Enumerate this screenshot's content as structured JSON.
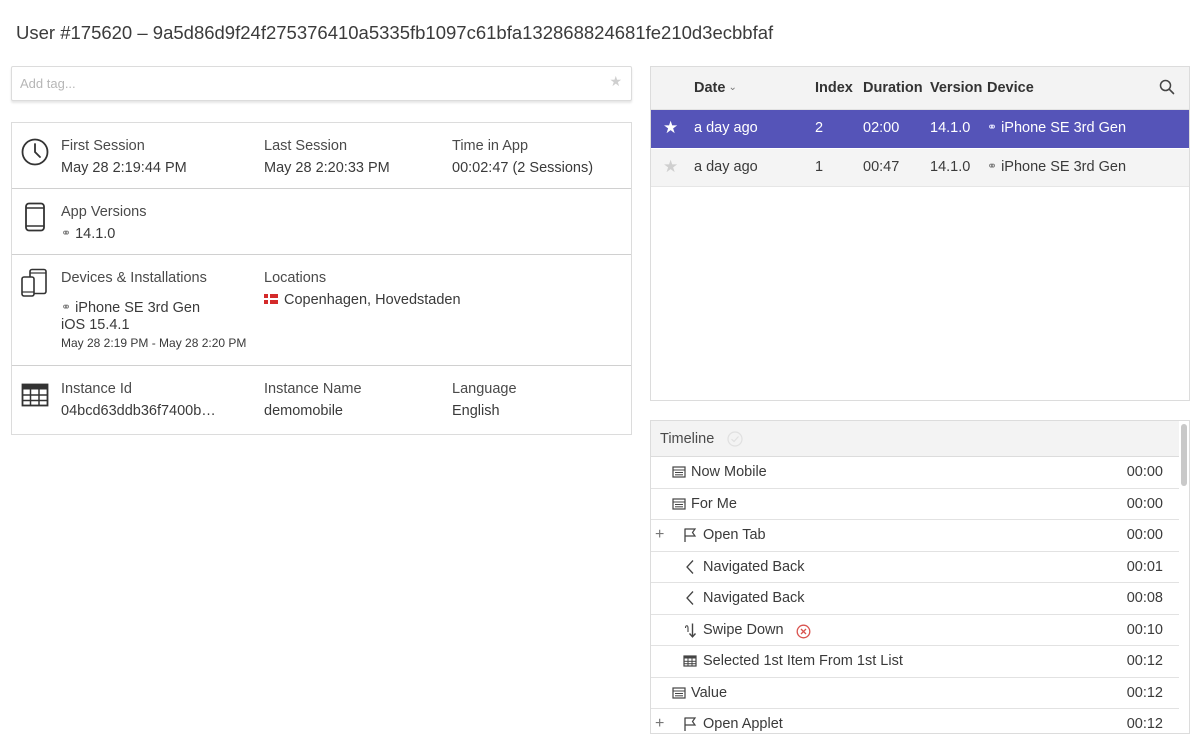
{
  "page": {
    "title": "User #175620 – 9a5d86d9f24f275376410a5335fb1097c61bfa132868824681fe210d3ecbbfaf"
  },
  "tags": {
    "placeholder": "Add tag..."
  },
  "info": {
    "first_session": {
      "label": "First Session",
      "value": "May 28 2:19:44 PM"
    },
    "last_session": {
      "label": "Last Session",
      "value": "May 28 2:20:33 PM"
    },
    "time_in_app": {
      "label": "Time in App",
      "value": "00:02:47 (2 Sessions)"
    },
    "app_versions": {
      "label": "App Versions",
      "value": "14.1.0"
    },
    "devices": {
      "label": "Devices & Installations",
      "device": "iPhone SE 3rd Gen",
      "os": "iOS 15.4.1",
      "range": "May 28 2:19 PM - May 28 2:20 PM"
    },
    "locations": {
      "label": "Locations",
      "value": "Copenhagen, Hovedstaden"
    },
    "instance_id": {
      "label": "Instance Id",
      "value": "04bcd63ddb36f7400b…"
    },
    "instance_name": {
      "label": "Instance Name",
      "value": "demomobile"
    },
    "language": {
      "label": "Language",
      "value": "English"
    }
  },
  "sessions": {
    "columns": {
      "date": "Date",
      "index": "Index",
      "duration": "Duration",
      "version": "Version",
      "device": "Device"
    },
    "rows": [
      {
        "date": "a day ago",
        "index": "2",
        "duration": "02:00",
        "version": "14.1.0",
        "device": "iPhone SE 3rd Gen",
        "selected": true
      },
      {
        "date": "a day ago",
        "index": "1",
        "duration": "00:47",
        "version": "14.1.0",
        "device": "iPhone SE 3rd Gen",
        "selected": false
      }
    ]
  },
  "timeline": {
    "title": "Timeline",
    "events": [
      {
        "label": "Now Mobile",
        "time": "00:00",
        "icon": "screen-icon"
      },
      {
        "label": "For Me",
        "time": "00:00",
        "icon": "screen-icon"
      },
      {
        "label": "Open Tab",
        "time": "00:00",
        "icon": "flag-icon",
        "expandable": true
      },
      {
        "label": "Navigated Back",
        "time": "00:01",
        "icon": "back-chevron-icon"
      },
      {
        "label": "Navigated Back",
        "time": "00:08",
        "icon": "back-chevron-icon"
      },
      {
        "label": "Swipe Down",
        "time": "00:10",
        "icon": "swipe-down-icon",
        "error": true
      },
      {
        "label": "Selected 1st Item From 1st List",
        "time": "00:12",
        "icon": "table-icon"
      },
      {
        "label": "Value",
        "time": "00:12",
        "icon": "screen-icon"
      },
      {
        "label": "Open Applet",
        "time": "00:12",
        "icon": "flag-icon",
        "expandable": true
      }
    ]
  },
  "colors": {
    "accent": "#5554b8",
    "error": "#d9534f"
  }
}
